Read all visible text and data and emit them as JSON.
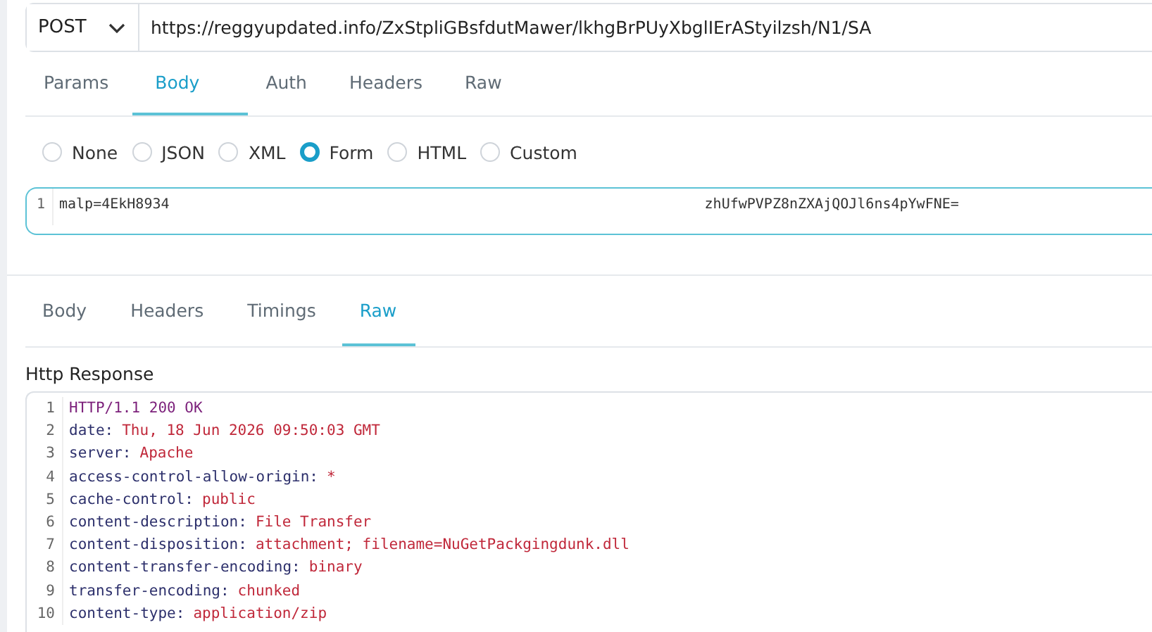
{
  "request": {
    "method": "POST",
    "url": "https://reggyupdated.info/ZxStpliGBsfdutMawer/lkhgBrPUyXbglIErAStyilzsh/N1/SA"
  },
  "request_tabs": [
    {
      "label": "Params",
      "selected": false
    },
    {
      "label": "Body",
      "selected": true
    },
    {
      "label": "Auth",
      "selected": false
    },
    {
      "label": "Headers",
      "selected": false
    },
    {
      "label": "Raw",
      "selected": false
    }
  ],
  "body_types": [
    {
      "label": "None",
      "selected": false
    },
    {
      "label": "JSON",
      "selected": false
    },
    {
      "label": "XML",
      "selected": false
    },
    {
      "label": "Form",
      "selected": true
    },
    {
      "label": "HTML",
      "selected": false
    },
    {
      "label": "Custom",
      "selected": false
    }
  ],
  "body_editor": {
    "line_number": "1",
    "text_start": "malp=4EkH8934",
    "text_end": "zhUfwPVPZ8nZXAjQOJl6ns4pYwFNE="
  },
  "response_tabs": [
    {
      "label": "Body",
      "selected": false
    },
    {
      "label": "Headers",
      "selected": false
    },
    {
      "label": "Timings",
      "selected": false
    },
    {
      "label": "Raw",
      "selected": true
    }
  ],
  "response": {
    "title": "Http Response",
    "lines": [
      {
        "number": "1",
        "kind": "status",
        "text": "HTTP/1.1 200 OK"
      },
      {
        "number": "2",
        "kind": "header",
        "key": "date:",
        "value": "Thu, 18 Jun 2026 09:50:03 GMT"
      },
      {
        "number": "3",
        "kind": "header",
        "key": "server:",
        "value": "Apache"
      },
      {
        "number": "4",
        "kind": "header",
        "key": "access-control-allow-origin:",
        "value": "*"
      },
      {
        "number": "5",
        "kind": "header",
        "key": "cache-control:",
        "value": "public"
      },
      {
        "number": "6",
        "kind": "header",
        "key": "content-description:",
        "value": "File Transfer"
      },
      {
        "number": "7",
        "kind": "header",
        "key": "content-disposition:",
        "value": "attachment; filename=NuGetPackgingdunk.dll"
      },
      {
        "number": "8",
        "kind": "header",
        "key": "content-transfer-encoding:",
        "value": "binary"
      },
      {
        "number": "9",
        "kind": "header",
        "key": "transfer-encoding:",
        "value": "chunked"
      },
      {
        "number": "10",
        "kind": "header",
        "key": "content-type:",
        "value": "application/zip"
      }
    ]
  }
}
